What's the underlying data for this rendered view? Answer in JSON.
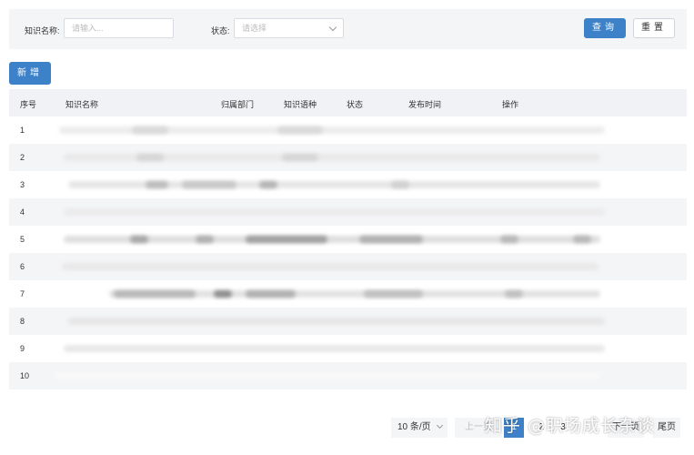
{
  "search": {
    "name_label": "知识名称:",
    "name_placeholder": "请输入...",
    "status_label": "状态:",
    "status_placeholder": "请选择",
    "query_label": "查询",
    "reset_label": "重置"
  },
  "toolbar": {
    "add_label": "新增"
  },
  "table": {
    "columns": [
      "序号",
      "知识名称",
      "归属部门",
      "知识语种",
      "状态",
      "发布时间",
      "操作"
    ],
    "rows": [
      "1",
      "2",
      "3",
      "4",
      "5",
      "6",
      "7",
      "8",
      "9",
      "10"
    ]
  },
  "pagination": {
    "page_size": "10 条/页",
    "prev_label": "上一页",
    "current_page": "1",
    "page_2": "2",
    "page_3": "3",
    "next_label": "下一页",
    "last_label": "尾页"
  },
  "watermark": "知乎 @职场成长杂谈",
  "colors": {
    "primary": "#3d82c8",
    "panel_bg": "#f4f5f7",
    "header_bg": "#f0f2f5"
  }
}
